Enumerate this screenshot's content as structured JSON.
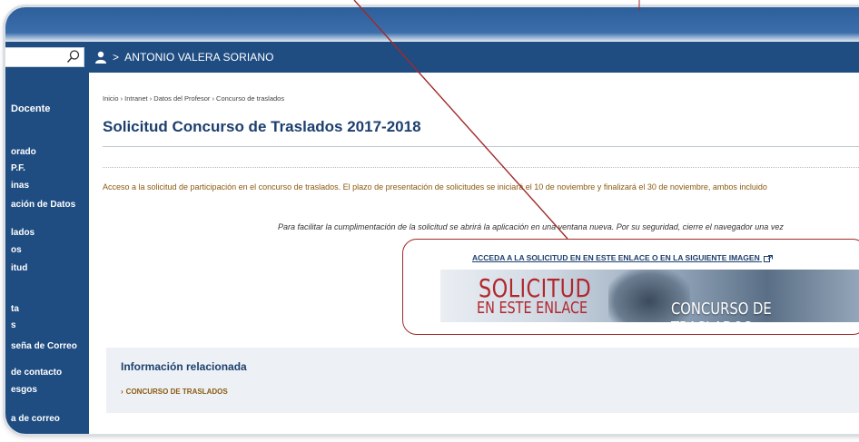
{
  "header": {
    "user_name": "ANTONIO VALERA SORIANO",
    "separator": ">"
  },
  "sidebar": {
    "title": "Docente",
    "items": [
      {
        "label": "orado"
      },
      {
        "label": "P.F."
      },
      {
        "label": "inas"
      },
      {
        "label": "ación de Datos"
      },
      {
        "label": "lados"
      },
      {
        "label": "os"
      },
      {
        "label": "itud"
      },
      {
        "label": "ta"
      },
      {
        "label": "s"
      },
      {
        "label": "seña de Correo"
      },
      {
        "label": "de contacto"
      },
      {
        "label": "esgos"
      },
      {
        "label": "a de correo"
      }
    ]
  },
  "main": {
    "breadcrumb": "Inicio › Intranet › Datos del Profesor › Concurso de traslados",
    "title": "Solicitud Concurso de Traslados 2017-2018",
    "description": "Acceso a la solicitud de participación en el concurso de traslados. El plazo de presentación de solicitudes se iniciará el 10 de noviembre y finalizará el 30 de noviembre, ambos incluido",
    "note": "Para facilitar la cumplimentación de la solicitud se abrirá la aplicación en una ventana nueva. Por su seguridad, cierre el navegador una vez",
    "link_text": "ACCEDA A LA SOLICITUD EN EN ESTE ENLACE O EN LA SIGUIENTE IMAGEN",
    "banner": {
      "line1": "SOLICITUD",
      "line2": "EN ESTE ENLACE",
      "line3": "CONCURSO DE TRASLADOS"
    }
  },
  "related": {
    "title": "Información relacionada",
    "link": "CONCURSO DE TRASLADOS",
    "link_arrow": "›"
  },
  "colors": {
    "nav_blue": "#1f4d82",
    "title_blue": "#1d3f6e",
    "text_brown": "#8a5a10",
    "annotation_red": "#a12a2a"
  }
}
